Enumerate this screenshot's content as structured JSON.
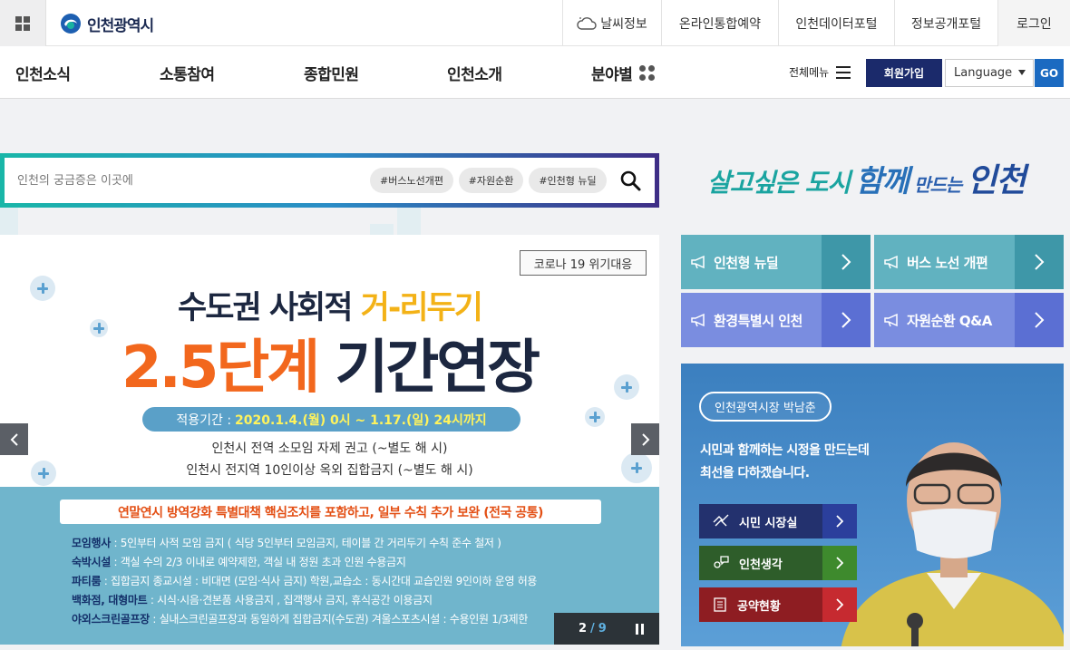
{
  "header": {
    "logo_text": "인천광역시",
    "util_links": {
      "weather": "날씨정보",
      "reservation": "온라인통합예약",
      "data_portal": "인천데이터포털",
      "info_portal": "정보공개포털",
      "login": "로그인"
    }
  },
  "gnb": {
    "items": [
      "인천소식",
      "소통참여",
      "종합민원",
      "인천소개",
      "분야별"
    ],
    "all_menu": "전체메뉴",
    "join": "회원가입",
    "language": "Language",
    "go": "GO"
  },
  "search": {
    "placeholder": "인천의 궁금증은 이곳에",
    "tags": [
      "#버스노선개편",
      "#자원순환",
      "#인천형 뉴딜"
    ]
  },
  "slogan": {
    "part1": "살고싶은 도시",
    "part2": "함께",
    "part3": "만드는",
    "part4": "인천"
  },
  "banner": {
    "tag": "코로나 19 위기대응",
    "title1_a": "수도권 사회적 ",
    "title1_b": "거-리두기",
    "title2_a": "2.5단계",
    "title2_b": " 기간연장",
    "period_label": "적용기간 :",
    "period_value": "2020.1.4.(월) 0시 ~ 1.17.(일) 24시까지",
    "rule1": "인천시 전역 소모임 자제 권고 (~별도 해 시)",
    "rule2": "인천시 전지역 10인이상 옥외 집합금지 (~별도 해 시)",
    "headline": "연말연시 방역강화 특별대책 핵심조치를 포함하고, 일부 수칙 추가 보완 (전국 공통)",
    "lines": [
      {
        "key": "모임행사",
        "text": " : 5인부터 사적 모임 금지 ( 식당 5인부터 모임금지, 테이블 간 거리두기 수칙 준수 철저 )"
      },
      {
        "key": "숙박시설",
        "text": " : 객실 수의 2/3 이내로 예약제한, 객실 내 정원 초과 인원 수용금지"
      },
      {
        "key": "파티룸",
        "text": " : 집합금지   종교시설 : 비대면 (모임·식사 금지)  학원,교습소 : 동시간대 교습인원 9인이하 운영 허용"
      },
      {
        "key": "백화점, 대형마트",
        "text": " : 시식·시음·견본품 사용금지 , 집객행사 금지, 휴식공간 이용금지"
      },
      {
        "key": "야외스크린골프장",
        "text": " : 실내스크린골프장과 동일하게 집합금지(수도권)  겨울스포츠시설 : 수용인원 1/3제한"
      }
    ],
    "current_slide": "2",
    "separator": "/",
    "total_slides": "9"
  },
  "quick_links": [
    "인천형 뉴딜",
    "버스 노선 개편",
    "환경특별시 인천",
    "자원순환 Q&A"
  ],
  "mayor": {
    "name": "인천광역시장 박남춘",
    "msg1": "시민과 함께하는 시정을 만드는데",
    "msg2": "최선을 다하겠습니다.",
    "buttons": [
      "시민 시장실",
      "인천생각",
      "공약현황"
    ]
  },
  "colors": {
    "navy": "#1b2a6b",
    "teal": "#61b2c0",
    "periwinkle": "#7a8de0",
    "banner_orange": "#f2671d",
    "banner_yellow": "#f3b217"
  }
}
